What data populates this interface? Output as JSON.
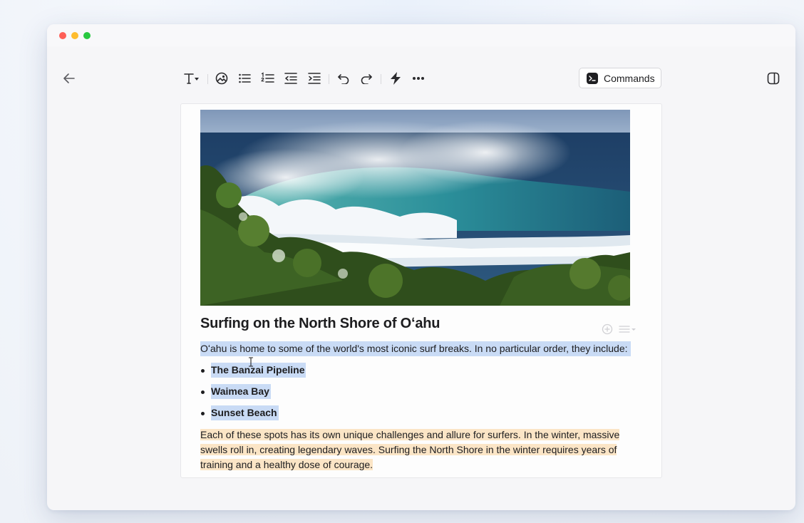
{
  "toolbar": {
    "commands_label": "Commands"
  },
  "document": {
    "title": "Surfing on the North Shore of Oʻahu",
    "intro": "Oʻahu is home to some of the world's most iconic surf breaks. In no particular order, they include:",
    "list_items": [
      "The Banzai Pipeline",
      "Waimea Bay",
      "Sunset Beach"
    ],
    "paragraph": "Each of these spots has its own unique challenges and allure for surfers. In the winter, massive swells roll in, creating legendary waves. Surfing the North Shore in the winter requires years of training and a healthy dose of courage."
  },
  "colors": {
    "selection": "#c9dbf5",
    "highlight": "#fbe5c6"
  }
}
